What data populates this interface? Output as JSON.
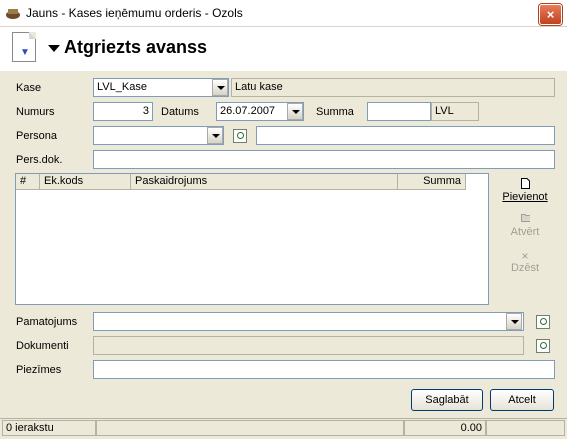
{
  "window": {
    "title": "Jauns - Kases ieņēmumu orderis - Ozols",
    "close_label": "×"
  },
  "header": {
    "title": "Atgriezts avanss"
  },
  "form": {
    "kase_label": "Kase",
    "kase_value": "LVL_Kase",
    "kase_name": "Latu kase",
    "numurs_label": "Numurs",
    "numurs_value": "3",
    "datums_label": "Datums",
    "datums_value": "26.07.2007",
    "summa_label": "Summa",
    "summa_value": "",
    "currency": "LVL",
    "persona_label": "Persona",
    "persona_value": "",
    "persona_name": "",
    "persdok_label": "Pers.dok.",
    "persdok_value": ""
  },
  "grid": {
    "columns": [
      "#",
      "Ek.kods",
      "Paskaidrojums",
      "Summa"
    ],
    "rows": []
  },
  "side_buttons": {
    "add": "Pievienot",
    "open": "Atvērt",
    "delete": "Dzēst"
  },
  "lower": {
    "pamatojums_label": "Pamatojums",
    "pamatojums_value": "",
    "dokumenti_label": "Dokumenti",
    "dokumenti_value": "",
    "piezimes_label": "Piezīmes",
    "piezimes_value": ""
  },
  "buttons": {
    "save": "Saglabāt",
    "cancel": "Atcelt"
  },
  "status": {
    "records": "0 ierakstu",
    "total": "0.00"
  }
}
